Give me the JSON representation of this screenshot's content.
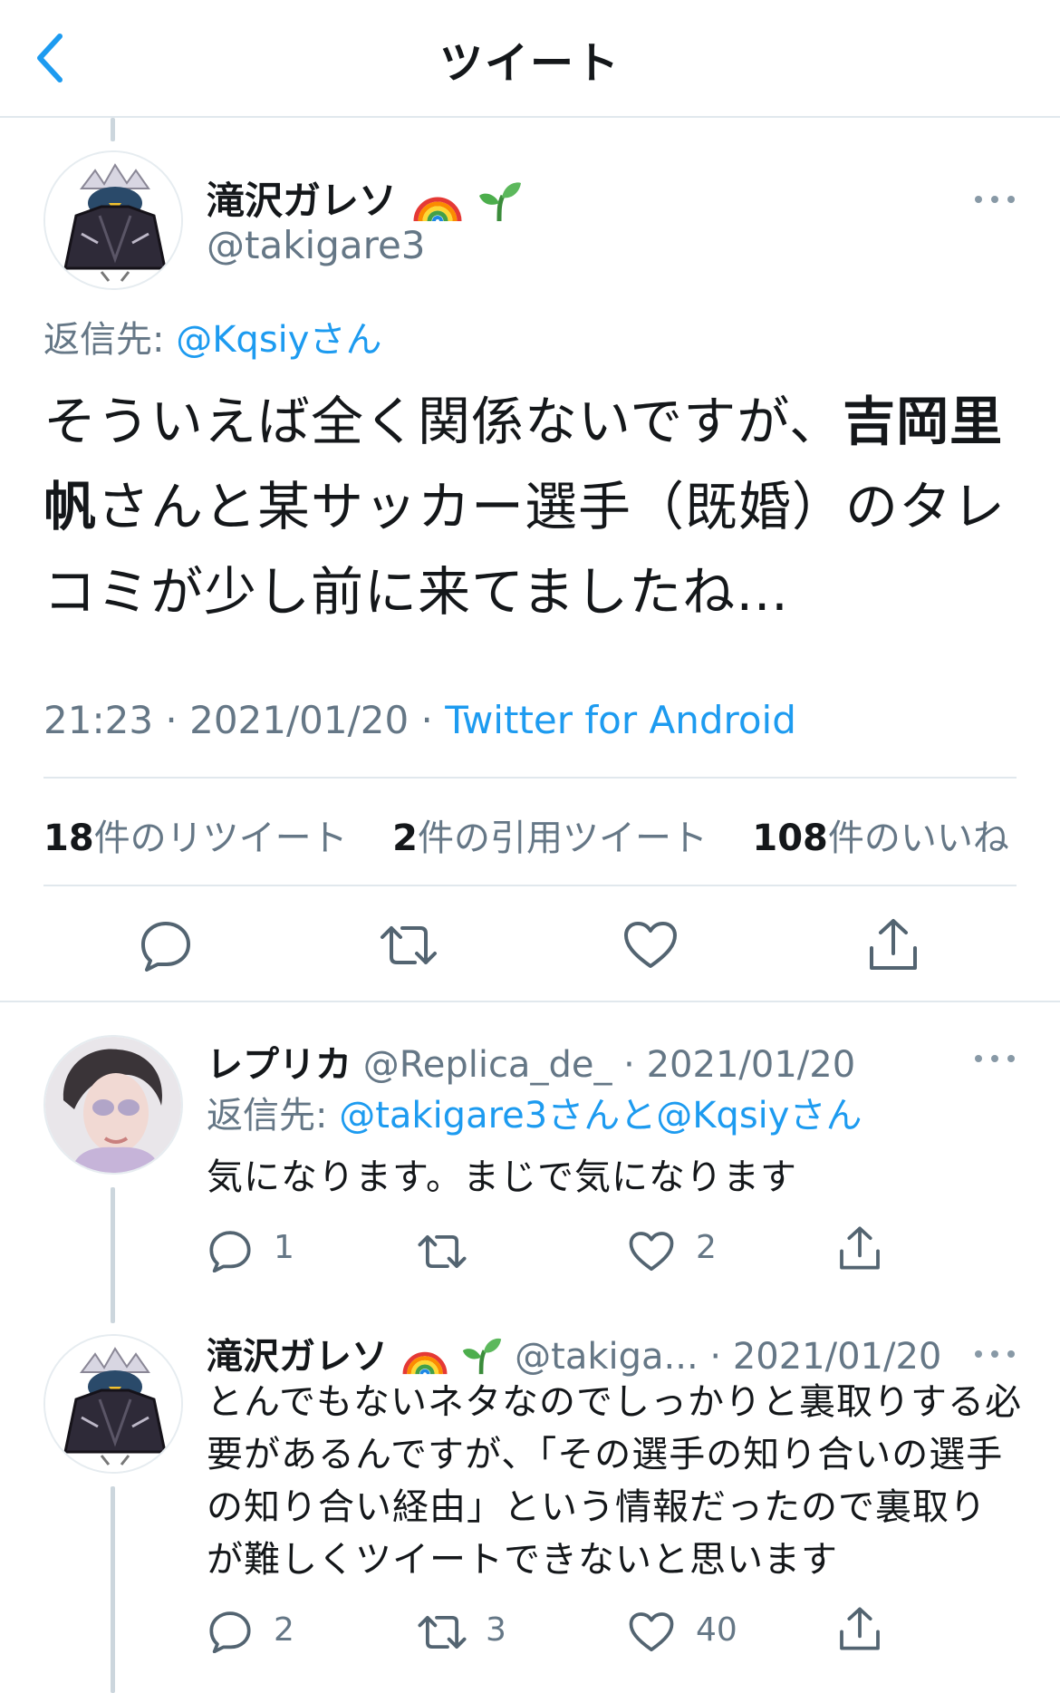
{
  "header": {
    "title": "ツイート"
  },
  "main_tweet": {
    "display_name": "滝沢ガレソ",
    "handle": "@takigare3",
    "reply_prefix": "返信先: ",
    "reply_to": "@Kqsiyさん",
    "text_part1": "そういえば全く関係ないですが、",
    "text_bold": "吉岡里帆",
    "text_part2": "さんと某サッカー選手（既婚）のタレコミが少し前に来てましたね…",
    "time": "21:23",
    "date": "2021/01/20",
    "source": "Twitter for Android",
    "stats": {
      "retweets_num": "18",
      "retweets_label": "件のリツイート",
      "quotes_num": "2",
      "quotes_label": "件の引用ツイート",
      "likes_num": "108",
      "likes_label": "件のいいね"
    }
  },
  "replies": [
    {
      "display_name": "レプリカ",
      "handle": "@Replica_de_",
      "date": "· 2021/01/20",
      "reply_prefix": "返信先: ",
      "reply_to": "@takigare3さんと@Kqsiyさん",
      "text": "気になります。まじで気になります",
      "reply_count": "1",
      "retweet_count": "",
      "like_count": "2"
    },
    {
      "display_name": "滝沢ガレソ",
      "handle": "@takiga...",
      "date": "· 2021/01/20",
      "text": "とんでもないネタなのでしっかりと裏取りする必要があるんですが、「その選手の知り合いの選手の知り合い経由」という情報だったので裏取りが難しくツイートできないと思います",
      "reply_count": "2",
      "retweet_count": "3",
      "like_count": "40"
    }
  ],
  "colors": {
    "accent": "#1d9bf0",
    "muted": "#657786",
    "divider": "#e1e8ed"
  }
}
